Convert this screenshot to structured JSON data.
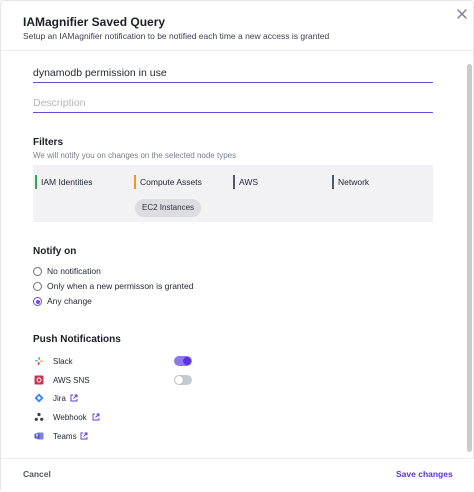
{
  "header": {
    "title": "IAMagnifier Saved Query",
    "subtitle": "Setup an IAMagnifier notification to be notified each time a new access is granted"
  },
  "form": {
    "name_value": "dynamodb permission in use",
    "description_placeholder": "Description"
  },
  "filters": {
    "title": "Filters",
    "hint": "We will notify you on changes on the selected node types",
    "nodes": [
      {
        "label": "IAM Identities",
        "color": "#2fa84f"
      },
      {
        "label": "Compute Assets",
        "color": "#f0962e"
      },
      {
        "label": "AWS",
        "color": "#555866"
      },
      {
        "label": "Network",
        "color": "#555866"
      }
    ],
    "chip": "EC2 Instances"
  },
  "notify": {
    "title": "Notify on",
    "options": [
      {
        "label": "No notification",
        "checked": false
      },
      {
        "label": "Only when a new permisson is granted",
        "checked": false
      },
      {
        "label": "Any change",
        "checked": true
      }
    ]
  },
  "push": {
    "title": "Push Notifications",
    "items": [
      {
        "label": "Slack",
        "icon": "slack-icon",
        "toggle": true
      },
      {
        "label": "AWS SNS",
        "icon": "aws-sns-icon",
        "toggle": false
      },
      {
        "label": "Jira",
        "icon": "jira-icon",
        "external": true
      },
      {
        "label": "Webhook",
        "icon": "webhook-icon",
        "external": true
      },
      {
        "label": "Teams",
        "icon": "teams-icon",
        "external": true
      }
    ]
  },
  "footer": {
    "cancel_label": "Cancel",
    "save_label": "Save changes"
  },
  "colors": {
    "accent": "#5b34d6",
    "iam": "#2fa84f",
    "compute": "#f0962e"
  }
}
